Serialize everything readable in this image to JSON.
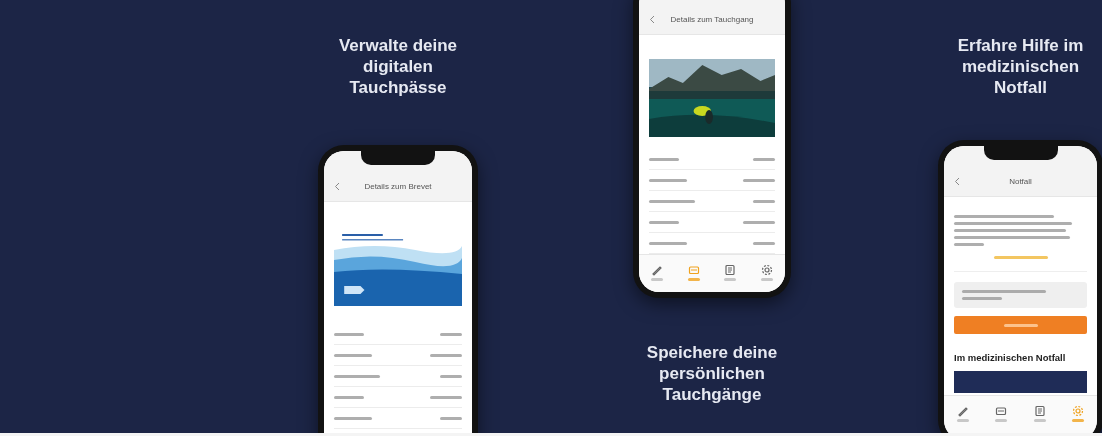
{
  "panels": [
    {
      "kind": "passes",
      "caption": "Verwalte deine digitalen Tauchpässe",
      "screen_title": "Details zum Brevet"
    },
    {
      "kind": "dives",
      "caption": "Speichere deine persönlichen Tauchgänge",
      "screen_title": "Details zum Tauchgang",
      "tabs": [
        {
          "kind": "pen",
          "selected": false
        },
        {
          "kind": "pass",
          "selected": true
        },
        {
          "kind": "log",
          "selected": false
        },
        {
          "kind": "settings",
          "selected": false
        }
      ]
    },
    {
      "kind": "emergency",
      "caption": "Erfahre Hilfe im medizinischen Notfall",
      "screen_title": "Notfall",
      "heading": "Im medizinischen Notfall",
      "tabs": [
        {
          "kind": "pen",
          "selected": false
        },
        {
          "kind": "pass",
          "selected": false
        },
        {
          "kind": "log",
          "selected": false
        },
        {
          "kind": "settings",
          "selected": true
        }
      ]
    }
  ]
}
